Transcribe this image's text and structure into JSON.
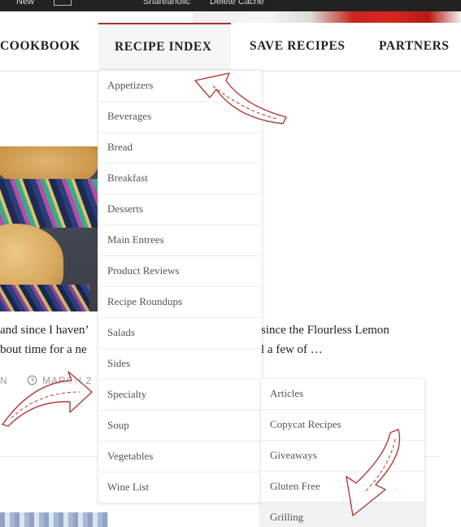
{
  "admin_bar": {
    "new_label": "New",
    "shareaholic_label": "Shareaholic",
    "delete_cache_label": "Delete Cache"
  },
  "nav": {
    "items": [
      {
        "label": "COOKBOOK"
      },
      {
        "label": "RECIPE INDEX"
      },
      {
        "label": "SAVE RECIPES"
      },
      {
        "label": "PARTNERS"
      }
    ],
    "active": "RECIPE INDEX"
  },
  "recipe_index_menu": {
    "items": [
      {
        "label": "Appetizers"
      },
      {
        "label": "Beverages"
      },
      {
        "label": "Bread"
      },
      {
        "label": "Breakfast"
      },
      {
        "label": "Desserts"
      },
      {
        "label": "Main Entrees"
      },
      {
        "label": "Product Reviews"
      },
      {
        "label": "Recipe Roundups"
      },
      {
        "label": "Salads"
      },
      {
        "label": "Sides"
      },
      {
        "label": "Specialty"
      },
      {
        "label": "Soup"
      },
      {
        "label": "Vegetables"
      },
      {
        "label": "Wine List"
      }
    ]
  },
  "specialty_submenu": {
    "items": [
      {
        "label": "Articles"
      },
      {
        "label": "Copycat Recipes"
      },
      {
        "label": "Giveaways"
      },
      {
        "label": "Gluten Free"
      },
      {
        "label": "Grilling"
      }
    ],
    "highlighted": "Grilling"
  },
  "post": {
    "excerpt_line1_left": "and since I haven’",
    "excerpt_line1_right": "since the Flourless Lemon",
    "excerpt_line2_left": "bout time for  a ne",
    "excerpt_line2_right": "l a few of …",
    "meta_left": "N",
    "meta_date": "MARCH 2"
  },
  "colors": {
    "accent": "#a3332f",
    "arrow_stroke": "#b23a3a",
    "menu_text": "#555555"
  },
  "icons": {
    "clock": "clock-icon",
    "arrow": "hand-drawn-arrow-icon"
  }
}
